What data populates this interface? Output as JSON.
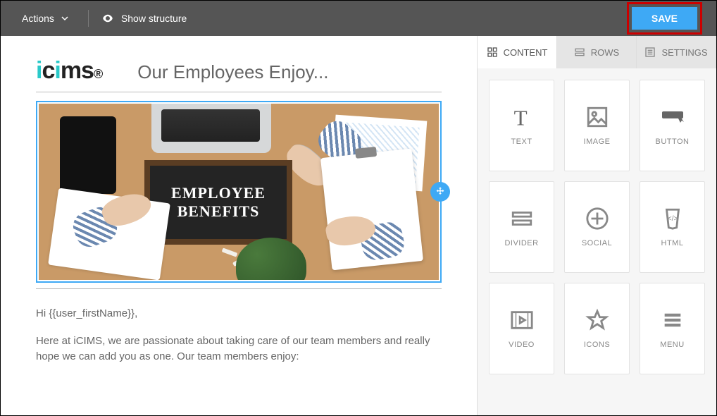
{
  "toolbar": {
    "actions_label": "Actions",
    "show_structure_label": "Show structure",
    "save_label": "SAVE"
  },
  "email": {
    "logo_text": "icims",
    "headline": "Our Employees Enjoy...",
    "hero_line1": "EMPLOYEE",
    "hero_line2": "BENEFITS",
    "greeting": "Hi {{user_firstName}},",
    "paragraph": "Here at iCIMS, we are passionate about taking care of our team members and really hope we can add you as one.  Our team members enjoy:"
  },
  "sidebar": {
    "tabs": {
      "content": "CONTENT",
      "rows": "ROWS",
      "settings": "SETTINGS"
    },
    "tiles": {
      "text": "TEXT",
      "image": "IMAGE",
      "button": "BUTTON",
      "divider": "DIVIDER",
      "social": "SOCIAL",
      "html": "HTML",
      "video": "VIDEO",
      "icons": "ICONS",
      "menu": "MENU"
    }
  }
}
